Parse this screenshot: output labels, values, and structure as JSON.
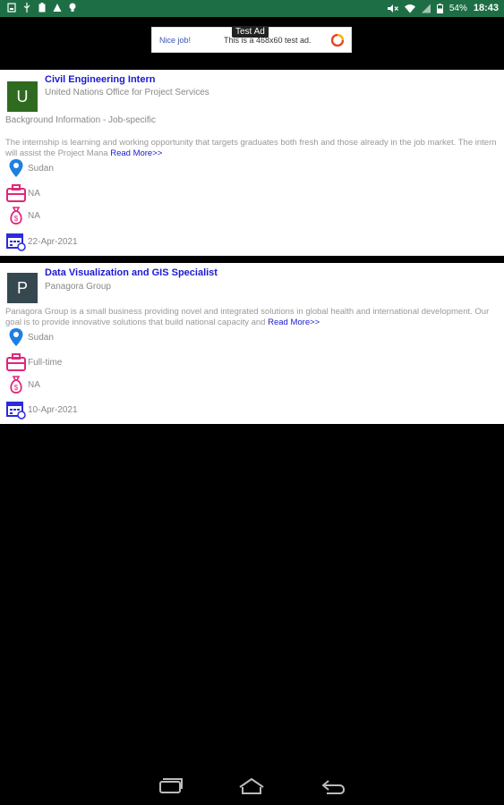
{
  "status_bar": {
    "battery": "54%",
    "time": "18:43"
  },
  "ad": {
    "left_text": "Nice job!",
    "mid_text": "This is a 468x60 test ad.",
    "tag": "Test Ad"
  },
  "jobs": [
    {
      "avatar_letter": "U",
      "avatar_color": "#2f6b1f",
      "title": "Civil Engineering Intern",
      "company": "United Nations Office for Project Services",
      "background_info": "Background Information - Job-specific",
      "description": "The internship is learning and working opportunity that targets graduates both fresh and those already in the job market. The intern will assist the Project Mana",
      "read_more": "Read More>>",
      "location": "Sudan",
      "job_type": "NA",
      "salary": "NA",
      "date": "22-Apr-2021"
    },
    {
      "avatar_letter": "P",
      "avatar_color": "#35474f",
      "title": "Data Visualization and GIS Specialist",
      "company": "Panagora Group",
      "description": "Panagora Group is a small business providing novel and integrated solutions in global health and international development. Our goal is to provide innovative solutions that build national capacity and",
      "read_more": "Read More>>",
      "location": "Sudan",
      "job_type": "Full-time",
      "salary": "NA",
      "date": "10-Apr-2021"
    }
  ],
  "colors": {
    "status_bar": "#1e6e45",
    "title_link": "#1a1ad2",
    "location_icon": "#1e7fe0",
    "briefcase_icon": "#e0277a",
    "salary_icon": "#e0277a",
    "calendar_icon": "#2a2adf"
  },
  "icons": {
    "location": "map-pin-icon",
    "job_type": "briefcase-icon",
    "salary": "money-bag-icon",
    "date": "calendar-icon"
  }
}
